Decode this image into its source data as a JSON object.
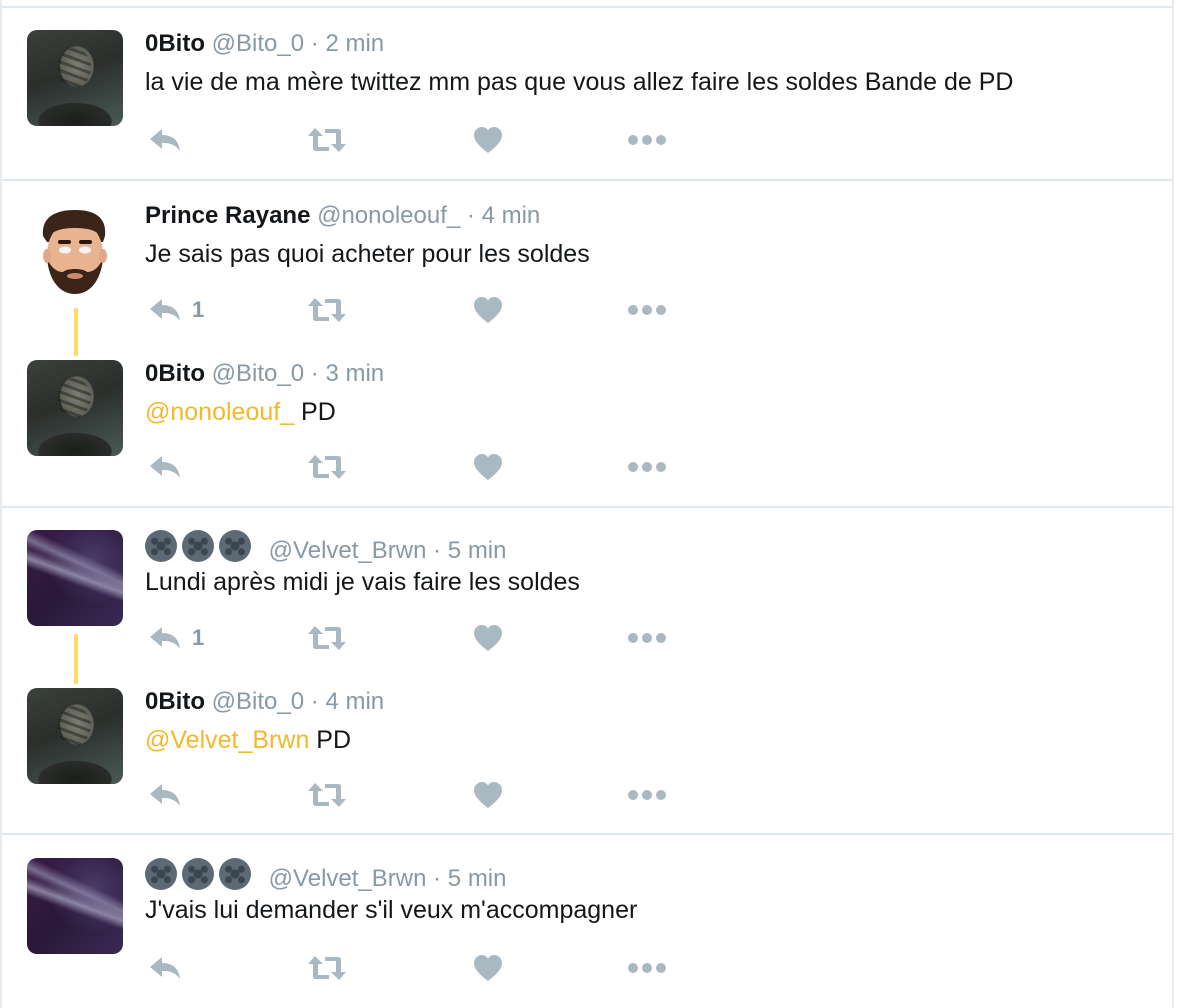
{
  "tweets": [
    {
      "name": "0Bito",
      "handle": "@Bito_0",
      "separator": "·",
      "time": "2 min",
      "text": "la vie de ma mère twittez mm pas que vous allez faire les soldes Bande de PD",
      "reply_count": ""
    },
    {
      "name": "Prince Rayane",
      "handle": "@nonoleouf_",
      "separator": "·",
      "time": "4 min",
      "text": "Je sais pas quoi acheter pour les soldes",
      "reply_count": "1"
    },
    {
      "name": "0Bito",
      "handle": "@Bito_0",
      "separator": "·",
      "time": "3 min",
      "mention": "@nonoleouf_",
      "text": " PD",
      "reply_count": ""
    },
    {
      "name_icons": [
        "film-reel-icon",
        "film-reel-icon",
        "film-reel-icon"
      ],
      "handle": "@Velvet_Brwn",
      "separator": "·",
      "time": "5 min",
      "text": "Lundi après midi je vais faire les soldes",
      "reply_count": "1"
    },
    {
      "name": "0Bito",
      "handle": "@Bito_0",
      "separator": "·",
      "time": "4 min",
      "mention": "@Velvet_Brwn",
      "text": " PD",
      "reply_count": ""
    },
    {
      "name_icons": [
        "film-reel-icon",
        "film-reel-icon",
        "film-reel-icon"
      ],
      "handle": "@Velvet_Brwn",
      "separator": "·",
      "time": "5 min",
      "text": "J'vais lui demander s'il veux m'accompagner",
      "reply_count": ""
    }
  ],
  "colors": {
    "mention": "#f4b82a",
    "thread_line": "#ffd866",
    "muted": "#8899a6",
    "action_icon": "#aab8c2"
  },
  "icons": {
    "reply": "reply-icon",
    "retweet": "retweet-icon",
    "like": "heart-icon",
    "more": "more-dots-icon"
  }
}
